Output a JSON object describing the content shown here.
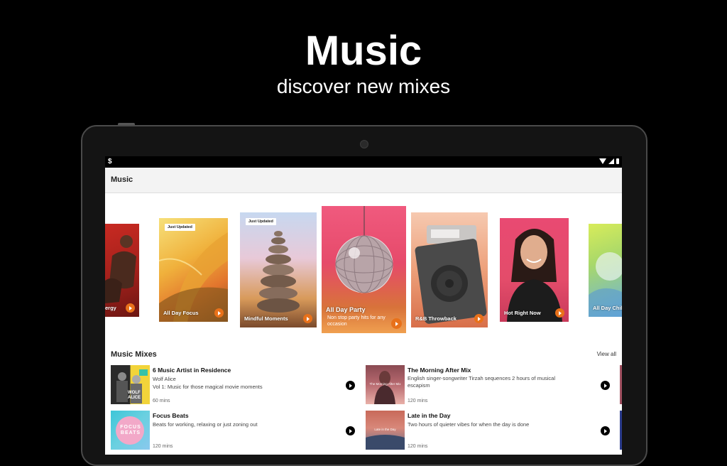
{
  "promo": {
    "title": "Music",
    "subtitle": "discover new mixes"
  },
  "status": {
    "left_glyph": "$"
  },
  "appbar": {
    "title": "Music"
  },
  "carousel": [
    {
      "label": "ergy",
      "badge": "",
      "desc": ""
    },
    {
      "label": "All Day Focus",
      "badge": "Just Updated",
      "desc": ""
    },
    {
      "label": "Mindful Moments",
      "badge": "Just Updated",
      "desc": ""
    },
    {
      "label": "All Day Party",
      "badge": "",
      "desc": "Non stop party hits for any occasion"
    },
    {
      "label": "R&B Throwback",
      "badge": "",
      "desc": ""
    },
    {
      "label": "Hot Right Now",
      "badge": "",
      "desc": ""
    },
    {
      "label": "All Day Chill",
      "badge": "",
      "desc": ""
    }
  ],
  "mixes": {
    "heading": "Music Mixes",
    "view_all": "View all",
    "items": [
      {
        "title": "6 Music Artist in Residence",
        "line1": "Wolf Alice",
        "line2": "Vol 1: Music for those magical movie moments",
        "duration": "60 mins",
        "thumb_text": "WOLF ALICE"
      },
      {
        "title": "The Morning After Mix",
        "line1": "English singer-songwriter Tirzah sequences 2 hours of musical escapism",
        "line2": "",
        "duration": "120 mins",
        "thumb_text": "The Morning After Mix"
      },
      {
        "title": "Focus Beats",
        "line1": "Beats for working, relaxing or just zoning out",
        "line2": "",
        "duration": "120 mins",
        "thumb_text": "FOCUS BEATS"
      },
      {
        "title": "Late in the Day",
        "line1": "Two hours of quieter vibes for when the day is done",
        "line2": "",
        "duration": "120 mins",
        "thumb_text": "Late in the Day"
      }
    ]
  },
  "colors": {
    "accent_play": "#e8711a",
    "background": "#000000"
  }
}
